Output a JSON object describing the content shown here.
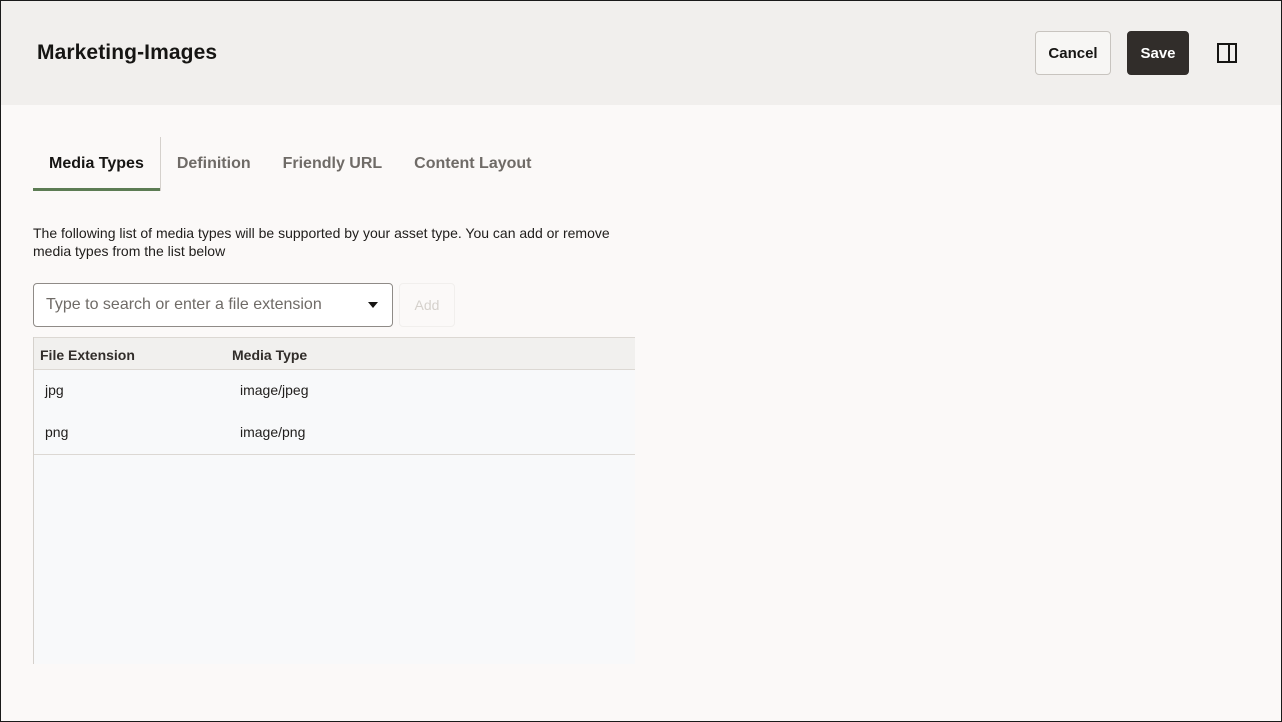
{
  "header": {
    "title": "Marketing-Images",
    "cancel_label": "Cancel",
    "save_label": "Save",
    "panel_icon": "panel-right-icon"
  },
  "tabs": [
    {
      "label": "Media Types",
      "active": true
    },
    {
      "label": "Definition",
      "active": false
    },
    {
      "label": "Friendly URL",
      "active": false
    },
    {
      "label": "Content Layout",
      "active": false
    }
  ],
  "description": "The following list of media types will be supported by your asset type. You can add or remove media types from the list below",
  "search": {
    "placeholder": "Type to search or enter a file extension",
    "value": "",
    "add_label": "Add"
  },
  "table": {
    "headers": {
      "extension": "File Extension",
      "media_type": "Media Type"
    },
    "rows": [
      {
        "extension": "jpg",
        "media_type": "image/jpeg"
      },
      {
        "extension": "png",
        "media_type": "image/png"
      }
    ]
  },
  "colors": {
    "accent_tab_underline": "#5c7c54",
    "primary_button": "#312d2a",
    "header_bg": "#f1efed"
  }
}
